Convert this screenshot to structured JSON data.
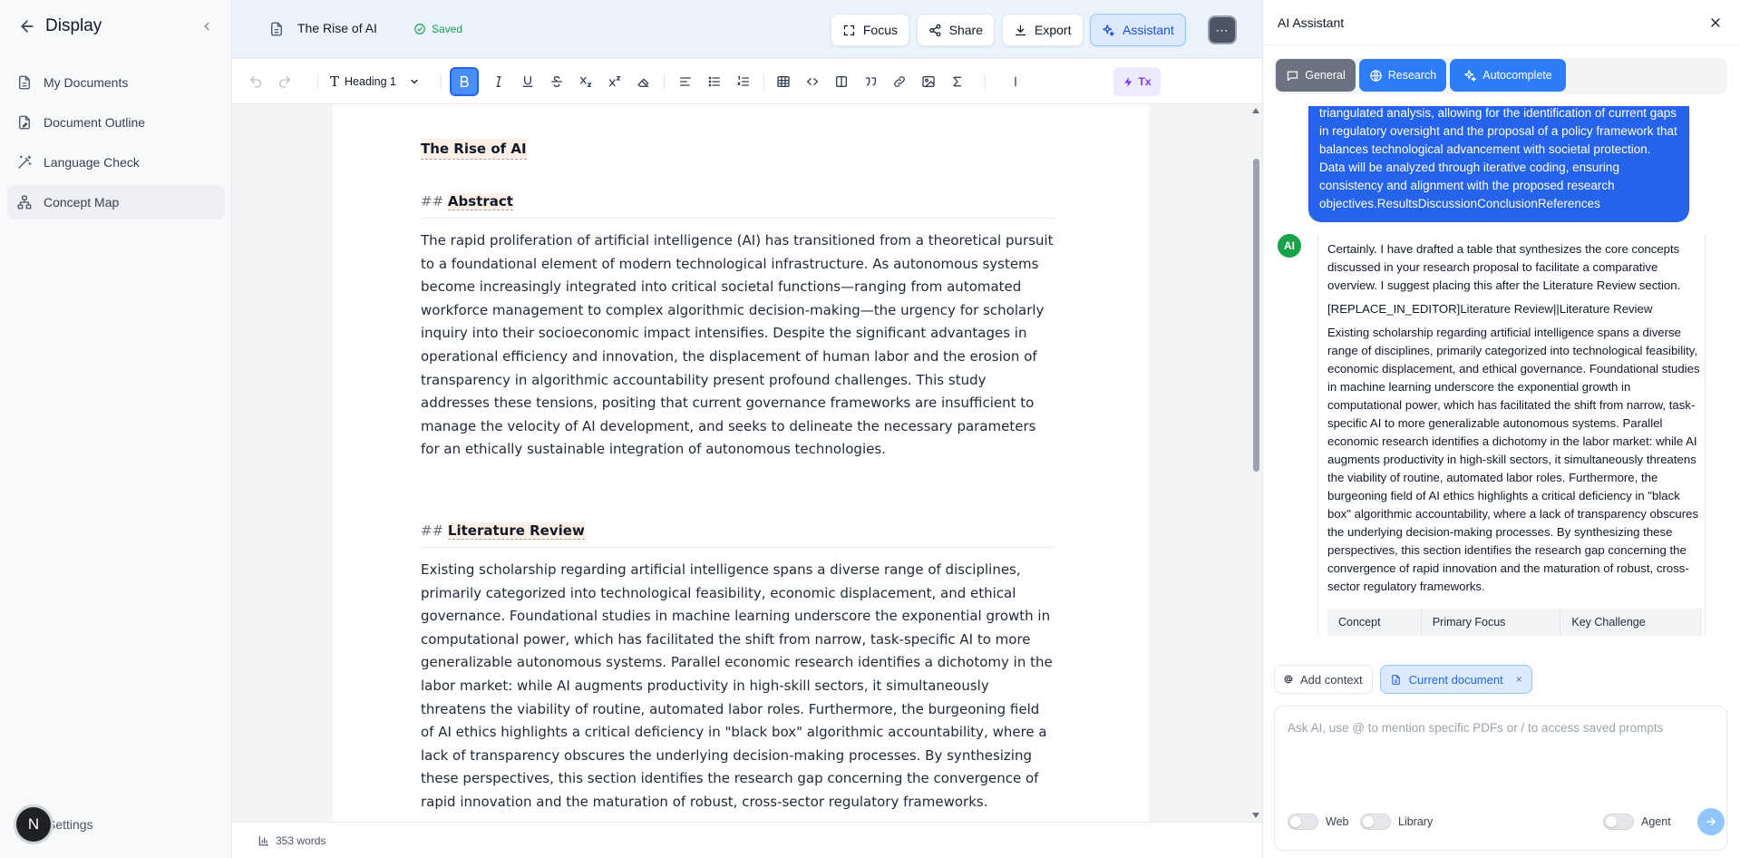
{
  "sidebar": {
    "title": "Display",
    "items": [
      {
        "label": "My Documents",
        "icon": "document-icon"
      },
      {
        "label": "Document Outline",
        "icon": "outline-icon"
      },
      {
        "label": "Language Check",
        "icon": "magic-wand-icon"
      },
      {
        "label": "Concept Map",
        "icon": "concept-map-icon"
      }
    ],
    "active_item": "Concept Map",
    "settings_label": "Settings",
    "avatar_letter": "N"
  },
  "header": {
    "doc_title": "The Rise of AI",
    "saved_label": "Saved",
    "buttons": {
      "focus": "Focus",
      "share": "Share",
      "export": "Export",
      "assistant": "Assistant"
    },
    "more": "⋯"
  },
  "toolbar": {
    "block_style": "Heading 1",
    "tx_label": "Tx"
  },
  "document": {
    "title": "The Rise of AI",
    "sections": [
      {
        "hash": "##",
        "heading": "Abstract",
        "body": "The rapid proliferation of artificial intelligence (AI) has transitioned from a theoretical pursuit to a foundational element of modern technological infrastructure. As autonomous systems become increasingly integrated into critical societal functions—ranging from automated workforce management to complex algorithmic decision-making—the urgency for scholarly inquiry into their socioeconomic impact intensifies. Despite the significant advantages in operational efficiency and innovation, the displacement of human labor and the erosion of transparency in algorithmic accountability present profound challenges. This study addresses these tensions, positing that current governance frameworks are insufficient to manage the velocity of AI development, and seeks to delineate the necessary parameters for an ethically sustainable integration of autonomous technologies."
      },
      {
        "hash": "##",
        "heading": "Literature Review",
        "body": "Existing scholarship regarding artificial intelligence spans a diverse range of disciplines, primarily categorized into technological feasibility, economic displacement, and ethical governance. Foundational studies in machine learning underscore the exponential growth in computational power, which has facilitated the shift from narrow, task-specific AI to more generalizable autonomous systems. Parallel economic research identifies a dichotomy in the labor market: while AI augments productivity in high-skill sectors, it simultaneously threatens the viability of routine, automated labor roles. Furthermore, the burgeoning field of AI ethics highlights a critical deficiency in \"black box\" algorithmic accountability, where a lack of transparency obscures the underlying decision-making processes. By synthesizing these perspectives, this section identifies the research gap concerning the convergence of rapid innovation and the maturation of robust, cross-sector regulatory frameworks."
      }
    ],
    "word_count": "353 words"
  },
  "assistant": {
    "title": "AI Assistant",
    "tabs": {
      "general": "General",
      "research": "Research",
      "autocomplete": "Autocomplete"
    },
    "user_message": "triangulated analysis, allowing for the identification of current gaps in regulatory oversight and the proposal of a policy framework that balances technological advancement with societal protection. Data will be analyzed through iterative coding, ensuring consistency and alignment with the proposed research objectives.ResultsDiscussionConclusionReferences",
    "ai_avatar": "AI",
    "ai_intro": "Certainly. I have drafted a table that synthesizes the core concepts discussed in your research proposal to facilitate a comparative overview. I suggest placing this after the Literature Review section.",
    "ai_replace": "[REPLACE_IN_EDITOR]Literature Review||Literature Review",
    "ai_body": "Existing scholarship regarding artificial intelligence spans a diverse range of disciplines, primarily categorized into technological feasibility, economic displacement, and ethical governance. Foundational studies in machine learning underscore the exponential growth in computational power, which has facilitated the shift from narrow, task-specific AI to more generalizable autonomous systems. Parallel economic research identifies a dichotomy in the labor market: while AI augments productivity in high-skill sectors, it simultaneously threatens the viability of routine, automated labor roles. Furthermore, the burgeoning field of AI ethics highlights a critical deficiency in \"black box\" algorithmic accountability, where a lack of transparency obscures the underlying decision-making processes. By synthesizing these perspectives, this section identifies the research gap concerning the convergence of rapid innovation and the maturation of robust, cross-sector regulatory frameworks.",
    "table_headers": [
      "Concept",
      "Primary Focus",
      "Key Challenge"
    ],
    "context": {
      "add": "Add context",
      "current": "Current document",
      "remove": "×"
    },
    "input_placeholder": "Ask AI, use @ to mention specific PDFs or / to access saved prompts",
    "toggles": {
      "web": "Web",
      "library": "Library",
      "agent": "Agent"
    }
  },
  "colors": {
    "primary": "#2563eb",
    "header_bg": "#eaf3fe",
    "saved_green": "#16a34a",
    "ai_avatar_green": "#16a34a",
    "heading_highlight": "#fdf0e7"
  }
}
